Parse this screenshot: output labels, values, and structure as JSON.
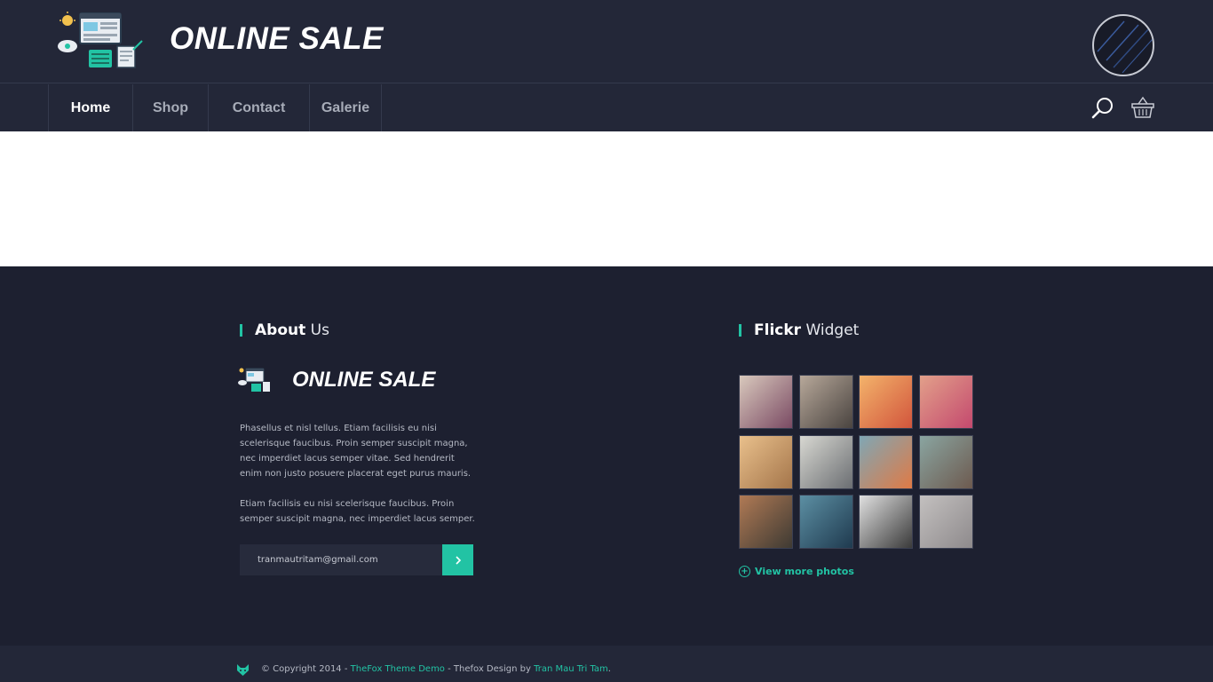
{
  "header": {
    "site_title": "ONLINE SALE",
    "logo_icon": "computer-workspace-icon",
    "avatar_icon": "avatar-icon"
  },
  "nav": {
    "items": [
      {
        "label": "Home",
        "active": true
      },
      {
        "label": "Shop",
        "active": false
      },
      {
        "label": "Contact",
        "active": false
      },
      {
        "label": "Galerie",
        "active": false
      }
    ],
    "search_icon": "search-icon",
    "cart_icon": "basket-icon"
  },
  "about": {
    "title_bold": "About",
    "title_light": "Us",
    "logo_title": "ONLINE SALE",
    "paragraph_1": "Phasellus et nisl tellus. Etiam facilisis eu nisi scelerisque faucibus. Proin semper suscipit magna, nec imperdiet lacus semper vitae. Sed hendrerit enim non justo posuere placerat eget purus mauris.",
    "paragraph_2": "Etiam facilisis eu nisi scelerisque faucibus. Proin semper suscipit magna, nec imperdiet lacus semper.",
    "email_value": "tranmautritam@gmail.com",
    "submit_icon": "chevron-right-icon"
  },
  "flickr": {
    "title_bold": "Flickr",
    "title_light": "Widget",
    "view_more": "View more photos",
    "photos": [
      {
        "name": "woman-with-hat-photo",
        "colors": [
          "#d9c9bd",
          "#7a4a63"
        ]
      },
      {
        "name": "legs-running-road-photo",
        "colors": [
          "#b7a89a",
          "#4a4440"
        ]
      },
      {
        "name": "couple-sunset-photo",
        "colors": [
          "#f3b36b",
          "#d2553c"
        ]
      },
      {
        "name": "girl-with-sunglasses-photo",
        "colors": [
          "#e2a08a",
          "#c4496e"
        ]
      },
      {
        "name": "city-skyline-photo",
        "colors": [
          "#e9c08c",
          "#a4754a"
        ]
      },
      {
        "name": "man-with-sunglasses-photo",
        "colors": [
          "#d8d8d2",
          "#6b6e72"
        ]
      },
      {
        "name": "man-with-megaphone-photo",
        "colors": [
          "#7fa7b5",
          "#e07a45"
        ]
      },
      {
        "name": "suitcase-legs-photo",
        "colors": [
          "#8aa5a1",
          "#6d5a4f"
        ]
      },
      {
        "name": "curly-hair-woman-photo",
        "colors": [
          "#b07a55",
          "#3e3a33"
        ]
      },
      {
        "name": "hands-cash-photo",
        "colors": [
          "#5c8fa3",
          "#1f3a4f"
        ]
      },
      {
        "name": "checkered-shirt-photo",
        "colors": [
          "#e0e0e0",
          "#3a3a3a"
        ]
      },
      {
        "name": "street-tram-photo",
        "colors": [
          "#c3c0bf",
          "#8e8a8c"
        ]
      }
    ]
  },
  "copyright": {
    "prefix": "© Copyright 2014 - ",
    "link1": "TheFox Theme Demo",
    "middle": " - Thefox Design by ",
    "link2": "Tran Mau Tri Tam",
    "suffix": ".",
    "icon": "fox-icon"
  },
  "colors": {
    "accent": "#22c3a4",
    "header_bg": "#232738",
    "footer_bg": "#1d2030"
  }
}
